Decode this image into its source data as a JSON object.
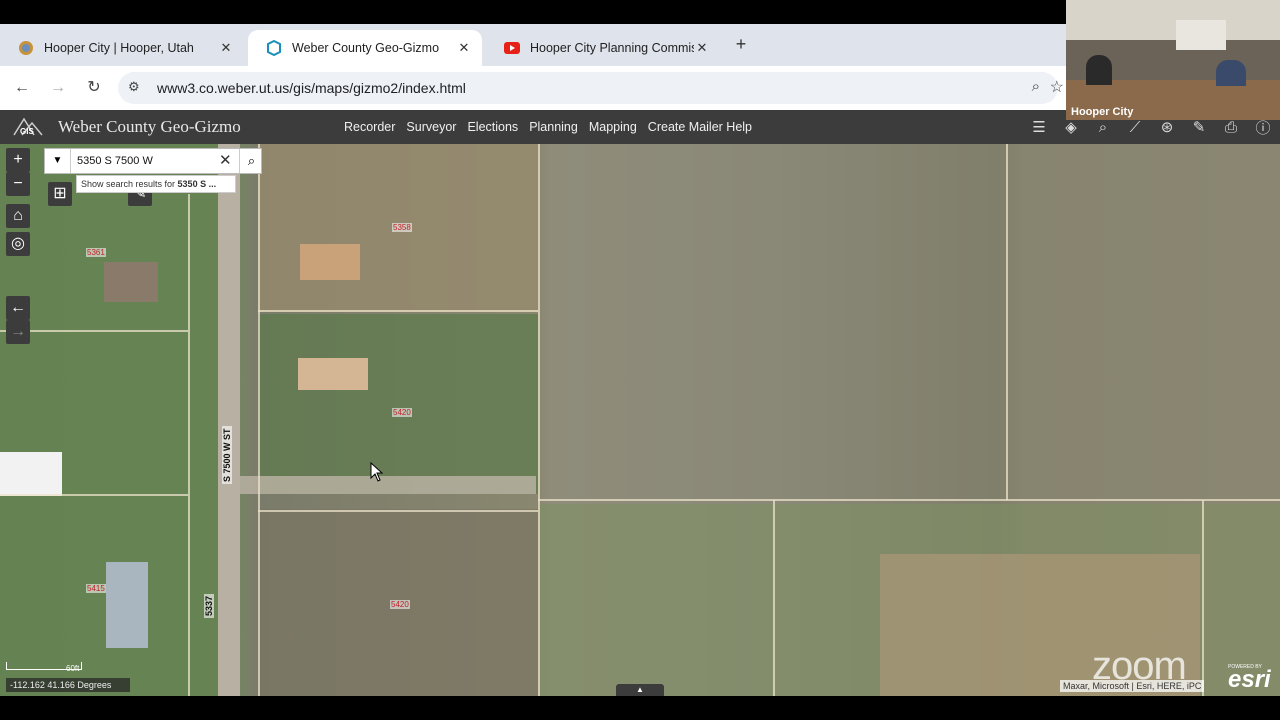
{
  "tabs": [
    {
      "label": "Hooper City | Hooper, Utah",
      "active": false
    },
    {
      "label": "Weber County Geo-Gizmo",
      "active": true
    },
    {
      "label": "Hooper City Planning Commiss",
      "active": false
    }
  ],
  "address": {
    "url": "www3.co.weber.ut.us/gis/maps/gizmo2/index.html"
  },
  "app": {
    "logo_text": "GIS",
    "title": "Weber County Geo-Gizmo",
    "menu": [
      "Recorder",
      "Surveyor",
      "Elections",
      "Planning",
      "Mapping",
      "Create Mailer Help"
    ]
  },
  "search": {
    "value": "5350 S 7500 W",
    "suggestion_prefix": "Show search results for ",
    "suggestion_bold": "5350 S ..."
  },
  "map": {
    "parcels": [
      "5358",
      "5361",
      "5420",
      "5415",
      "5420"
    ],
    "road_label": "S 7500 W ST",
    "road_label_2": "5337",
    "scale": "60ft",
    "coordinates": "-112.162 41.166 Degrees",
    "attribution": "Maxar, Microsoft | Esri, HERE, iPC",
    "esri_powered": "POWERED BY",
    "esri": "esri"
  },
  "zoom": {
    "watermark": "zoom",
    "participant_label": "Hooper City"
  },
  "colors": {
    "toolbar": "#3c3c3c",
    "tabbar": "#dfe3eb",
    "parcel_label": "#c0222a"
  }
}
